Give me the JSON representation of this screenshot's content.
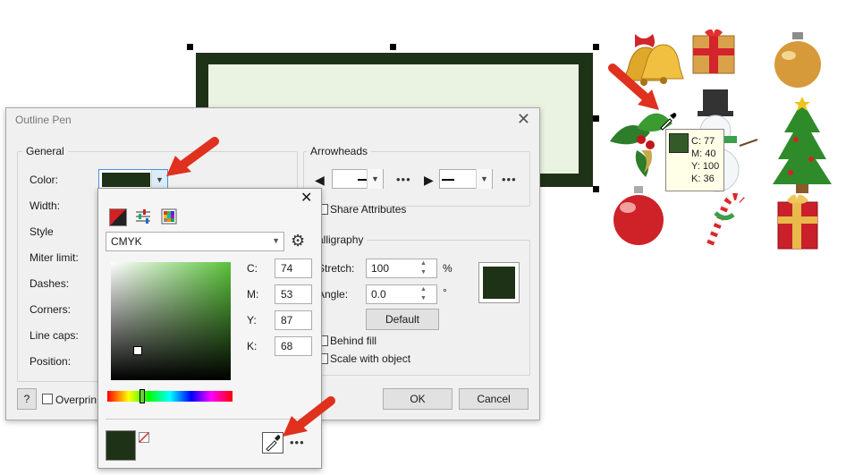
{
  "dialog": {
    "title": "Outline Pen",
    "close_glyph": "✕",
    "general": {
      "legend": "General",
      "labels": [
        "Color:",
        "Width:",
        "Style",
        "Miter limit:",
        "Dashes:",
        "Corners:",
        "Line caps:",
        "Position:"
      ]
    },
    "arrowheads": {
      "legend": "Arrowheads",
      "more": "•••"
    },
    "share_attributes": "Share Attributes",
    "calligraphy": {
      "legend": "alligraphy",
      "stretch_label": "Stretch:",
      "stretch_value": "100",
      "stretch_unit": "%",
      "angle_label": "Angle:",
      "angle_value": "0.0",
      "angle_unit": "°",
      "default_button": "Default"
    },
    "behind_fill": "Behind fill",
    "scale_with_object": "Scale with object",
    "help_button": "?",
    "overprint_label": "Overprin",
    "ok_button": "OK",
    "cancel_button": "Cancel",
    "color_swatch": "#1e3217"
  },
  "color_popup": {
    "close_glyph": "✕",
    "model": "CMYK",
    "channels": [
      {
        "label": "C:",
        "value": "74"
      },
      {
        "label": "M:",
        "value": "53"
      },
      {
        "label": "Y:",
        "value": "87"
      },
      {
        "label": "K:",
        "value": "68"
      }
    ],
    "current_color": "#1e3217",
    "more": "•••"
  },
  "eyedropper_tooltip": {
    "swatch": "#355a2a",
    "lines": [
      "C: 77",
      "M: 40",
      "Y: 100",
      "K: 36"
    ]
  },
  "colors": {
    "accent_arrow": "#e0301e",
    "rect_outline": "#1e3217",
    "rect_fill": "#eaf2e1"
  },
  "clipart": [
    "bells-icon",
    "gift-box-gold-icon",
    "ornament-gold-icon",
    "holly-icon",
    "snowman-icon",
    "christmas-tree-icon",
    "ornament-red-icon",
    "candy-cane-icon",
    "gift-box-red-icon"
  ]
}
